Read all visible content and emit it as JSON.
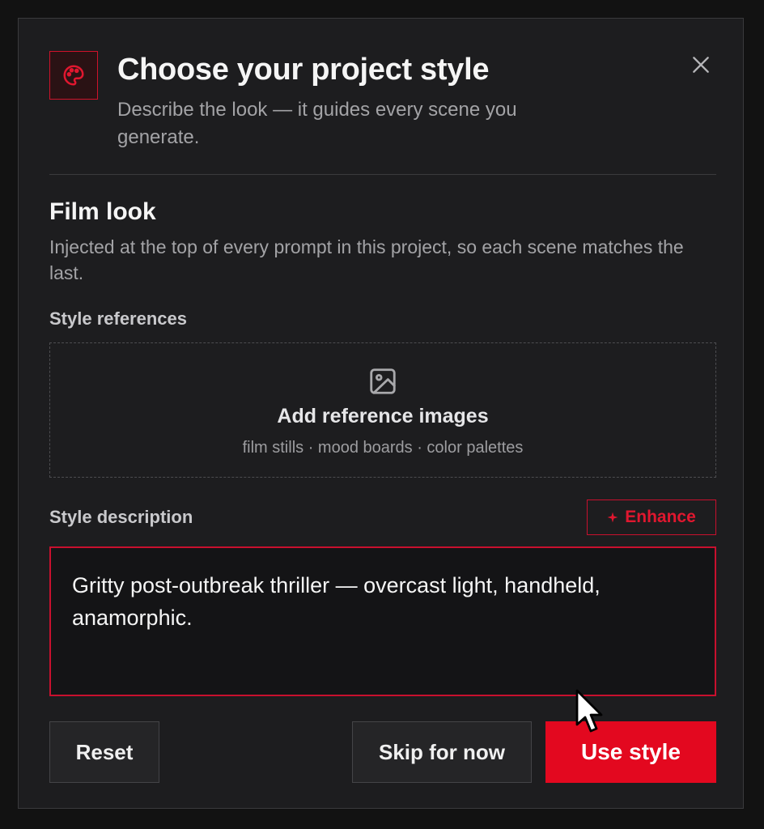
{
  "colors": {
    "accent": "#e3081f",
    "background": "#1d1d1f",
    "backdrop": "#121212",
    "muted_text": "#a3a3a6"
  },
  "header": {
    "icon": "palette-icon",
    "title": "Choose your project style",
    "subtitle": "Describe the look — it guides every scene you generate.",
    "close_icon": "close-icon"
  },
  "section": {
    "title": "Film look",
    "description": "Injected at the top of every prompt in this project, so each scene matches the last."
  },
  "references": {
    "label": "Style references",
    "icon": "image-icon",
    "title": "Add reference images",
    "subtitle": "film stills · mood boards · color palettes"
  },
  "description": {
    "label": "Style description",
    "enhance_icon": "sparkle-icon",
    "enhance_label": "Enhance",
    "value": "Gritty post-outbreak thriller — overcast light, handheld, anamorphic."
  },
  "actions": {
    "reset_label": "Reset",
    "skip_label": "Skip for now",
    "use_label": "Use style"
  }
}
